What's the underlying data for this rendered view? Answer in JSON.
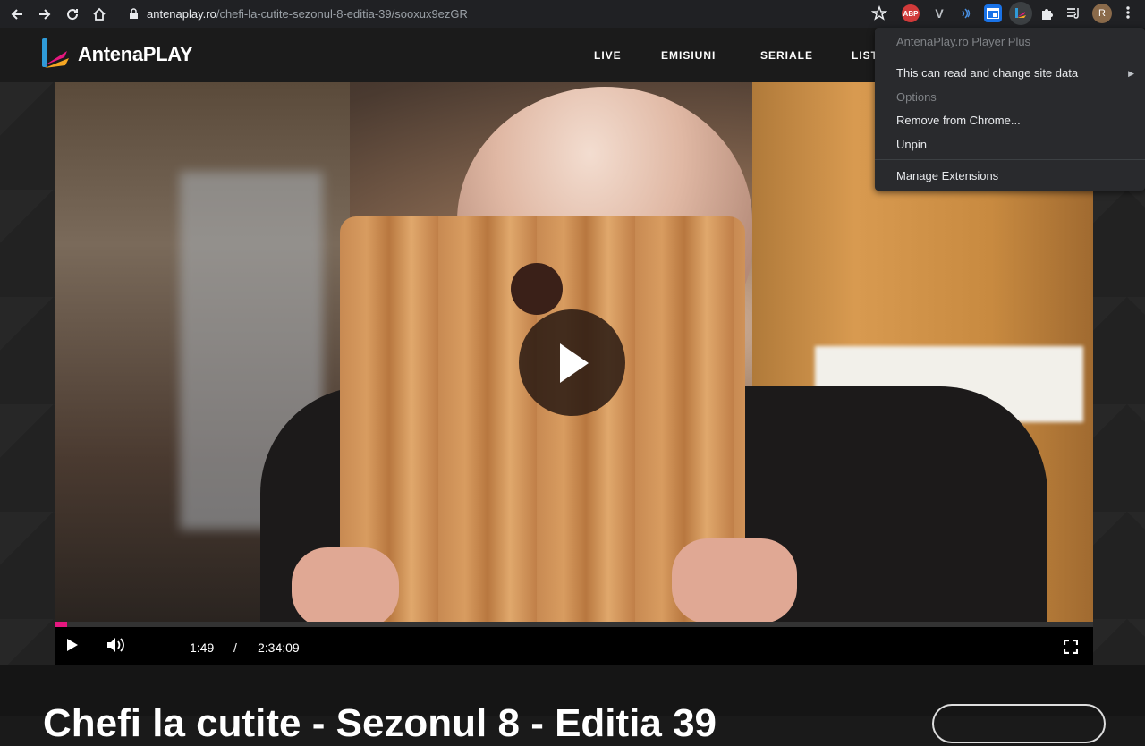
{
  "browser": {
    "url_host": "antenaplay.ro",
    "url_path": "/chefi-la-cutite-sezonul-8-editia-39/sooxux9ezGR",
    "extensions": {
      "abp_label": "ABP",
      "v_label": "V",
      "profile_initial": "R"
    }
  },
  "site": {
    "logo_text": "AntenaPLAY",
    "nav": [
      "LIVE",
      "EMISIUNI",
      "SERIALE",
      "LIST"
    ]
  },
  "player": {
    "current_time": "1:49",
    "separator": "/",
    "duration": "2:34:09",
    "progress_fraction": 0.012
  },
  "page": {
    "title": "Chefi la cutite - Sezonul 8 - Editia 39"
  },
  "context_menu": {
    "header": "AntenaPlay.ro Player Plus",
    "site_data": "This can read and change site data",
    "options": "Options",
    "remove": "Remove from Chrome...",
    "unpin": "Unpin",
    "manage": "Manage Extensions"
  },
  "colors": {
    "accent": "#e6177f",
    "toolbar": "#202124",
    "menu_bg": "#292a2d"
  }
}
